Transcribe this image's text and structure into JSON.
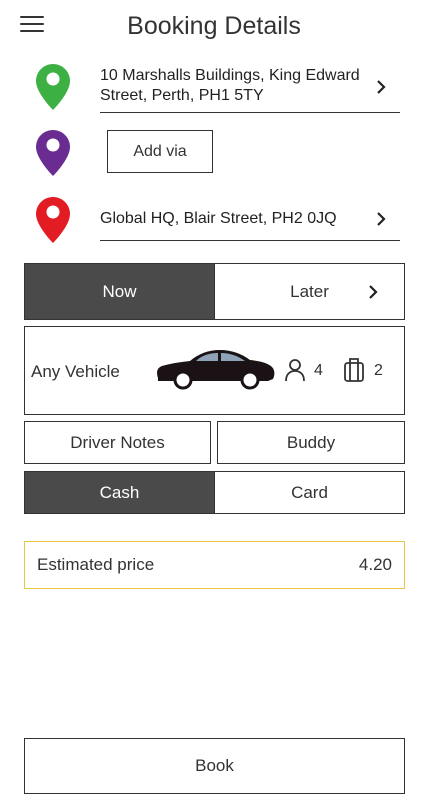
{
  "header": {
    "title": "Booking Details",
    "menu_icon": "hamburger-menu-icon"
  },
  "route": {
    "pickup": {
      "address": "10 Marshalls Buildings, King Edward Street, Perth, PH1 5TY",
      "pin_color": "#3cb043"
    },
    "via": {
      "label": "Add via",
      "pin_color": "#6a2c91"
    },
    "dropoff": {
      "address": "Global HQ, Blair Street, PH2 0JQ",
      "pin_color": "#e31b23"
    }
  },
  "timing": {
    "now_label": "Now",
    "later_label": "Later",
    "selected": "Now"
  },
  "vehicle": {
    "label": "Any Vehicle",
    "passengers": "4",
    "luggage": "2",
    "car_color": "#1a1214"
  },
  "options": {
    "driver_notes_label": "Driver Notes",
    "buddy_label": "Buddy"
  },
  "payment": {
    "cash_label": "Cash",
    "card_label": "Card",
    "selected": "Cash"
  },
  "estimate": {
    "label": "Estimated price",
    "value": "4.20",
    "border_color": "#e8c547"
  },
  "book_label": "Book",
  "colors": {
    "active_segment": "#4a4a4a",
    "text": "#333333"
  }
}
